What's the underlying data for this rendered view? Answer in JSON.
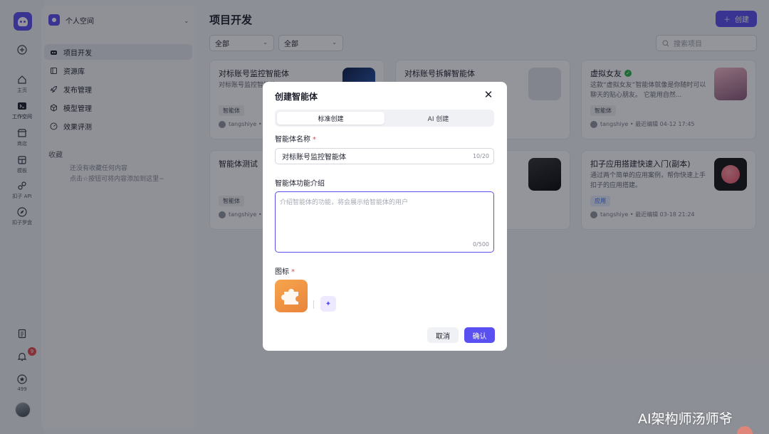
{
  "rail": {
    "home_label": "主页",
    "workspace_label": "工作空间",
    "store_label": "商店",
    "template_label": "模板",
    "api_label": "扣子 API",
    "explore_label": "扣子罗盘",
    "notification_count": "9",
    "points": "499"
  },
  "sidebar": {
    "workspace_name": "个人空间",
    "items": [
      {
        "label": "项目开发",
        "icon": "bot-icon"
      },
      {
        "label": "资源库",
        "icon": "library-icon"
      },
      {
        "label": "发布管理",
        "icon": "rocket-icon"
      },
      {
        "label": "模型管理",
        "icon": "cube-icon"
      },
      {
        "label": "效果评测",
        "icon": "gauge-icon"
      }
    ],
    "favorites_title": "收藏",
    "favorites_empty_line1": "还没有收藏任何内容",
    "favorites_empty_line2": "点击☆按钮可将内容添加到这里~"
  },
  "main": {
    "title": "项目开发",
    "create_label": "创建",
    "filter1": "全部",
    "filter2": "全部",
    "search_placeholder": "搜索项目",
    "cards": [
      {
        "title": "对标账号监控智能体",
        "desc": "对标账号监控智能体",
        "tag": "智能体",
        "meta": "tangshiye • 最"
      },
      {
        "title": "对标账号拆解智能体",
        "desc": "",
        "tag": "",
        "meta": ""
      },
      {
        "title": "虚拟女友",
        "desc": "这款“虚拟女友”智能体就像是你随时可以聊天的贴心朋友。 它能用自然...",
        "tag": "智能体",
        "meta": "tangshiye • 最近编辑 04-12 17:45"
      },
      {
        "title": "智能体测试",
        "desc": "",
        "tag": "智能体",
        "meta": "tangshiye • 最"
      },
      {
        "title": "",
        "desc": "",
        "tag": "",
        "meta": ""
      },
      {
        "title": "扣子应用搭建快速入门(副本)",
        "desc": "通过两个简单的应用案例，帮你快速上手扣子的应用搭建。",
        "tag": "应用",
        "meta": "tangshiye • 最近编辑 03-18 21:24"
      }
    ]
  },
  "modal": {
    "title": "创建智能体",
    "tab_standard": "标准创建",
    "tab_ai": "AI 创建",
    "name_label": "智能体名称",
    "name_value": "对标账号监控智能体",
    "name_count": "10/20",
    "desc_label": "智能体功能介绍",
    "desc_placeholder": "介绍智能体的功能，将会展示给智能体的用户",
    "desc_count": "0/500",
    "icon_label": "图标",
    "required_mark": "*",
    "cancel_label": "取消",
    "confirm_label": "确认"
  },
  "watermark": "AI架构师汤师爷",
  "colors": {
    "accent": "#5a4ff0",
    "required": "#e5484d",
    "verified": "#2fb24a"
  }
}
